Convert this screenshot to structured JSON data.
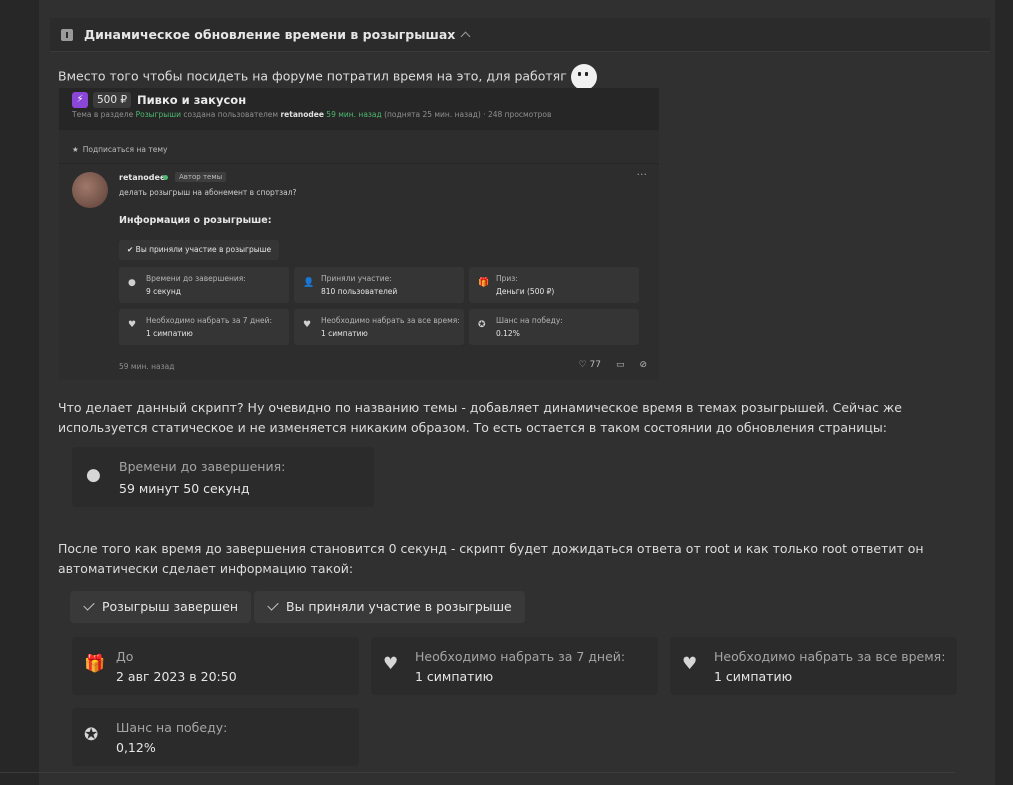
{
  "spoiler": {
    "title": "Динамическое обновление времени в розыгрышах"
  },
  "intro": "Вместо того чтобы посидеть на форуме потратил время на это, для работяг",
  "screenshot": {
    "price": "500 ₽",
    "thread_title": "Пивко и закусон",
    "meta_prefix": "Тема в разделе ",
    "meta_section": "Розыгрыши",
    "meta_mid": " создана пользователем ",
    "meta_user": "retanodee",
    "meta_time": " 59 мин. назад",
    "meta_suffix": " (поднята 25 мин. назад) · 248 просмотров",
    "subscribe": "Подписаться на тему",
    "username": "retanodee",
    "author_badge": "Автор темы",
    "question": "делать розыгрыш на абонемент в спортзал?",
    "info_title": "Информация о розыгрыше:",
    "participated": "Вы приняли участие в розыгрыше",
    "cells": [
      {
        "label": "Времени до завершения:",
        "value": "9 секунд"
      },
      {
        "label": "Приняли участие:",
        "value": "810 пользователей"
      },
      {
        "label": "Приз:",
        "value": "Деньги (500 ₽)"
      },
      {
        "label": "Необходимо набрать за 7 дней:",
        "value": "1 симпатию"
      },
      {
        "label": "Необходимо набрать за все время:",
        "value": "1 симпатию"
      },
      {
        "label": "Шанс на победу:",
        "value": "0.12%"
      }
    ],
    "ago": "59 мин. назад",
    "likes": "77"
  },
  "para2": "Что делает данный скрипт? Ну очевидно по названию темы - добавляет динамическое время в темах розыгрышей. Сейчас же используется статическое и не изменяется никаким образом. То есть остается в таком состоянии до обновления страницы:",
  "timer_cell": {
    "label": "Времени до завершения:",
    "value": "59 минут 50 секунд"
  },
  "para3": "После того как время до завершения становится 0 секунд - скрипт будет дожидаться ответа от root и как только root ответит он автоматически сделает информацию такой:",
  "buttons": {
    "finished": "Розыгрыш завершен",
    "participated": "Вы приняли участие в розыгрыше"
  },
  "final_cells": [
    {
      "label": "До",
      "value": "2 авг 2023 в 20:50"
    },
    {
      "label": "Необходимо набрать за 7 дней:",
      "value": "1 симпатию"
    },
    {
      "label": "Необходимо набрать за все время:",
      "value": "1 симпатию"
    },
    {
      "label": "Шанс на победу:",
      "value": "0,12%"
    }
  ]
}
